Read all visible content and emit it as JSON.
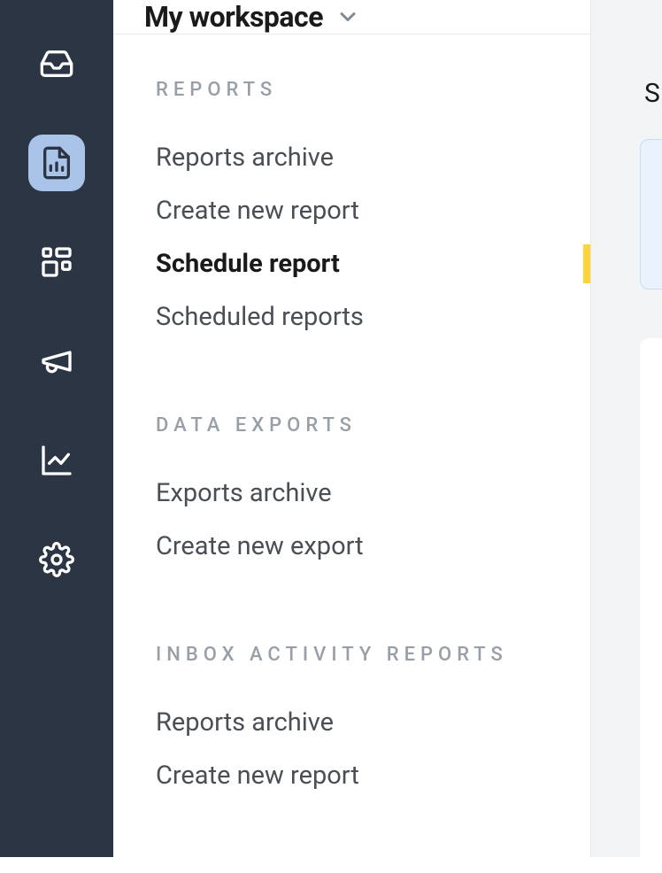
{
  "workspace": {
    "title": "My workspace"
  },
  "sections": [
    {
      "heading": "REPORTS",
      "items": [
        "Reports archive",
        "Create new report",
        "Schedule report",
        "Scheduled reports"
      ],
      "active_index": 2
    },
    {
      "heading": "DATA EXPORTS",
      "items": [
        "Exports archive",
        "Create new export"
      ]
    },
    {
      "heading": "INBOX ACTIVITY REPORTS",
      "items": [
        "Reports archive",
        "Create new report"
      ]
    }
  ],
  "content": {
    "heading_fragment": "S"
  }
}
